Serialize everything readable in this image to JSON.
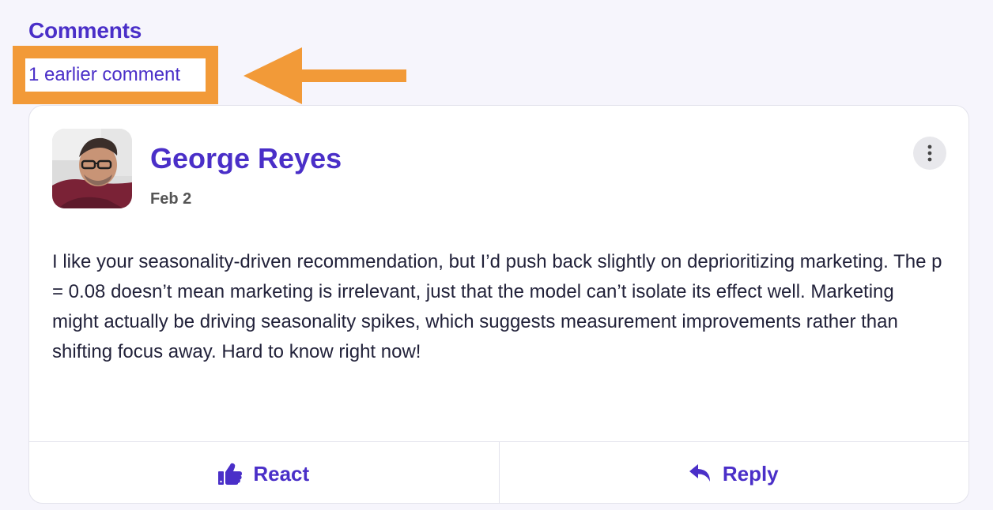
{
  "comments": {
    "heading": "Comments",
    "earlier_link": "1 earlier comment"
  },
  "annotation": {
    "highlight_color": "#f29a38"
  },
  "comment": {
    "author": "George Reyes",
    "date": "Feb 2",
    "body": "I like your seasonality-driven recommendation, but I’d push back slightly on deprioritizing marketing. The p = 0.08 doesn’t mean marketing is irrelevant, just that the model can’t isolate its effect well. Marketing might actually be driving seasonality spikes, which suggests measurement improvements rather than shifting focus away. Hard to know right now!",
    "more_icon": "vertical-ellipsis-icon"
  },
  "actions": {
    "react_label": "React",
    "react_icon": "thumbs-up-icon",
    "reply_label": "Reply",
    "reply_icon": "reply-arrow-icon"
  },
  "colors": {
    "accent": "#4a2fc8",
    "background": "#f6f5fc"
  }
}
